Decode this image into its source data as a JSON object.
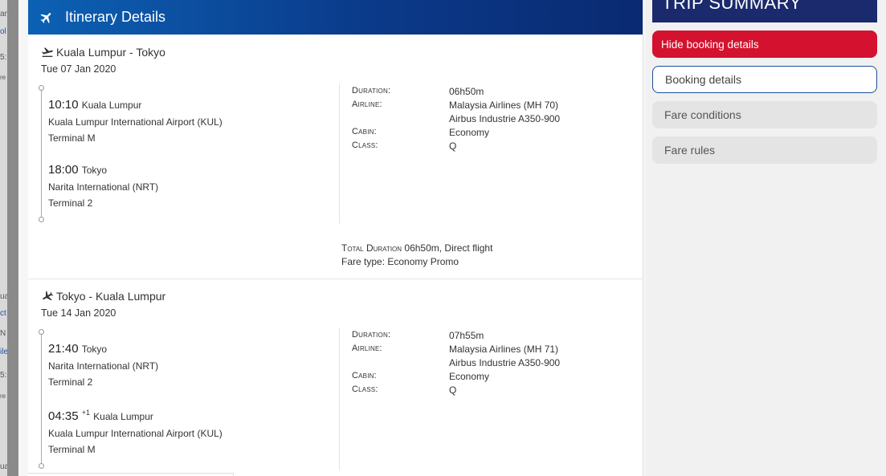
{
  "background_fragments": [
    "ar",
    "ol",
    "5:",
    "re",
    "ua",
    "ct",
    "N",
    "ile",
    "5:",
    "re",
    "ua"
  ],
  "itinerary": {
    "header_title": "Itinerary Details",
    "legs": [
      {
        "route": "Kuala Lumpur - Tokyo",
        "date": "Tue 07 Jan 2020",
        "departure": {
          "time": "10:10",
          "day_offset": "",
          "city": "Kuala Lumpur",
          "airport": "Kuala Lumpur International Airport (KUL)",
          "terminal": "Terminal M"
        },
        "arrival": {
          "time": "18:00",
          "day_offset": "",
          "city": "Tokyo",
          "airport": "Narita International (NRT)",
          "terminal": "Terminal 2"
        },
        "labels": {
          "duration": "Duration:",
          "airline": "Airline:",
          "cabin": "Cabin:",
          "class": "Class:"
        },
        "duration": "06h50m",
        "airline": "Malaysia Airlines (MH 70)",
        "aircraft": "Airbus Industrie A350-900",
        "cabin": "Economy",
        "class": "Q",
        "total_label": "Total Duration",
        "total_text": "06h50m, Direct flight",
        "fare_type": "Fare type: Economy Promo"
      },
      {
        "route": "Tokyo - Kuala Lumpur",
        "date": "Tue 14 Jan 2020",
        "departure": {
          "time": "21:40",
          "day_offset": "",
          "city": "Tokyo",
          "airport": "Narita International (NRT)",
          "terminal": "Terminal 2"
        },
        "arrival": {
          "time": "04:35",
          "day_offset": "+1",
          "city": "Kuala Lumpur",
          "airport": "Kuala Lumpur International Airport (KUL)",
          "terminal": "Terminal M"
        },
        "labels": {
          "duration": "Duration:",
          "airline": "Airline:",
          "cabin": "Cabin:",
          "class": "Class:"
        },
        "duration": "07h55m",
        "airline": "Malaysia Airlines (MH 71)",
        "aircraft": "Airbus Industrie A350-900",
        "cabin": "Economy",
        "class": "Q"
      }
    ]
  },
  "summary": {
    "header_title": "TRIP SUMMARY",
    "hide_details_label": "Hide booking details",
    "booking_details_label": "Booking details",
    "fare_conditions_label": "Fare conditions",
    "fare_rules_label": "Fare rules"
  },
  "colors": {
    "header_blue": "#0c61b4",
    "summary_navy": "#1a2a6c",
    "accent_red": "#d4112e",
    "outline_blue": "#1a4f9c"
  },
  "icons": {
    "header": "airplane-icon",
    "outbound": "departure-plane-icon",
    "return": "arrival-plane-icon"
  }
}
